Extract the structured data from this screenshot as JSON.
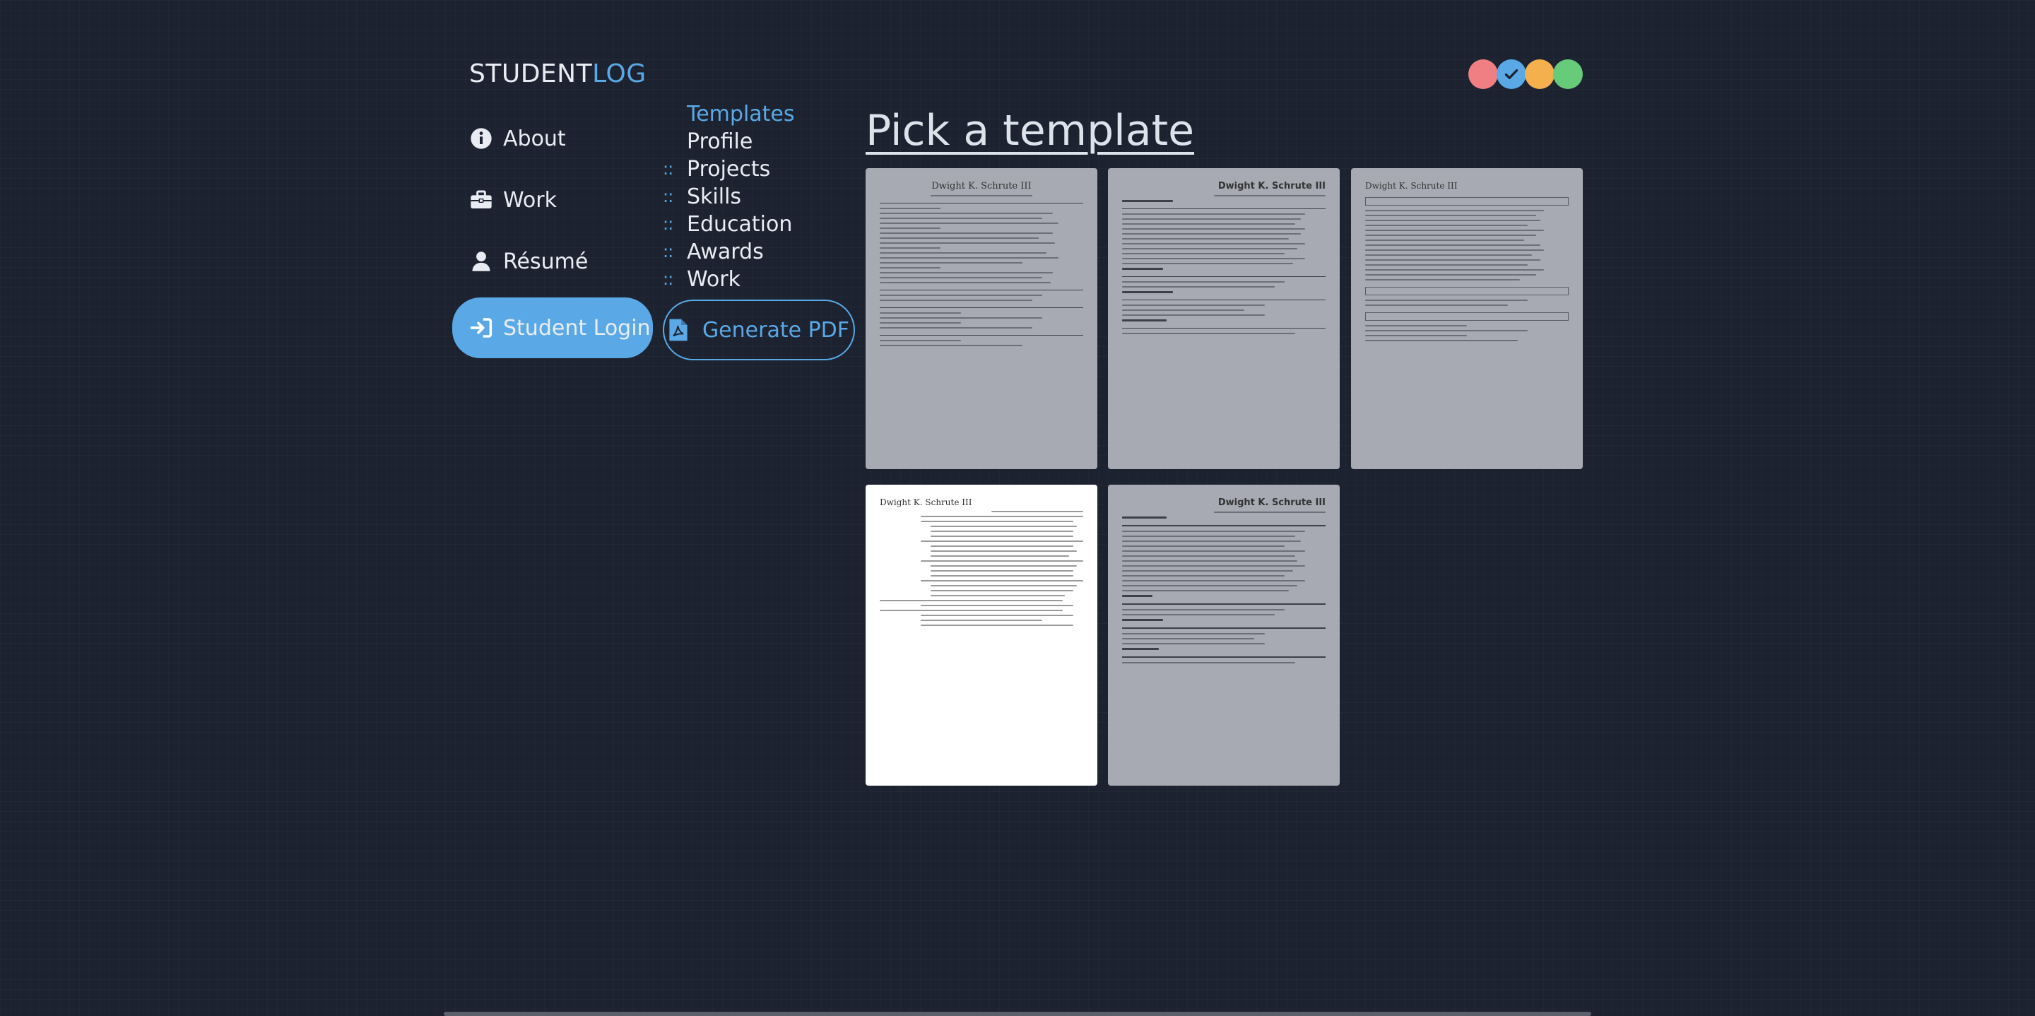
{
  "brand": {
    "part1": "STUDENT",
    "part2": "LOG"
  },
  "theme_dots": [
    {
      "color": "#f07f84",
      "selected": false
    },
    {
      "color": "#5aa9e6",
      "selected": true
    },
    {
      "color": "#f5b04e",
      "selected": false
    },
    {
      "color": "#67cc7a",
      "selected": false
    }
  ],
  "nav": {
    "about": "About",
    "work": "Work",
    "resume": "Résumé",
    "login": "Student Login"
  },
  "sections": {
    "items": [
      "Templates",
      "Profile",
      "Projects",
      "Skills",
      "Education",
      "Awards",
      "Work"
    ],
    "active": "Templates",
    "draggable_marker": "::"
  },
  "generate_button": "Generate PDF",
  "heading": "Pick a template",
  "templates": [
    {
      "name": "Dwight K. Schrute III",
      "selected": false
    },
    {
      "name": "Dwight K. Schrute III",
      "selected": false
    },
    {
      "name": "Dwight K. Schrute III",
      "selected": false
    },
    {
      "name": "Dwight K. Schrute III",
      "selected": true
    },
    {
      "name": "Dwight K. Schrute III",
      "selected": false
    }
  ],
  "colors": {
    "accent": "#5aa9e6",
    "background": "#1c2230"
  }
}
